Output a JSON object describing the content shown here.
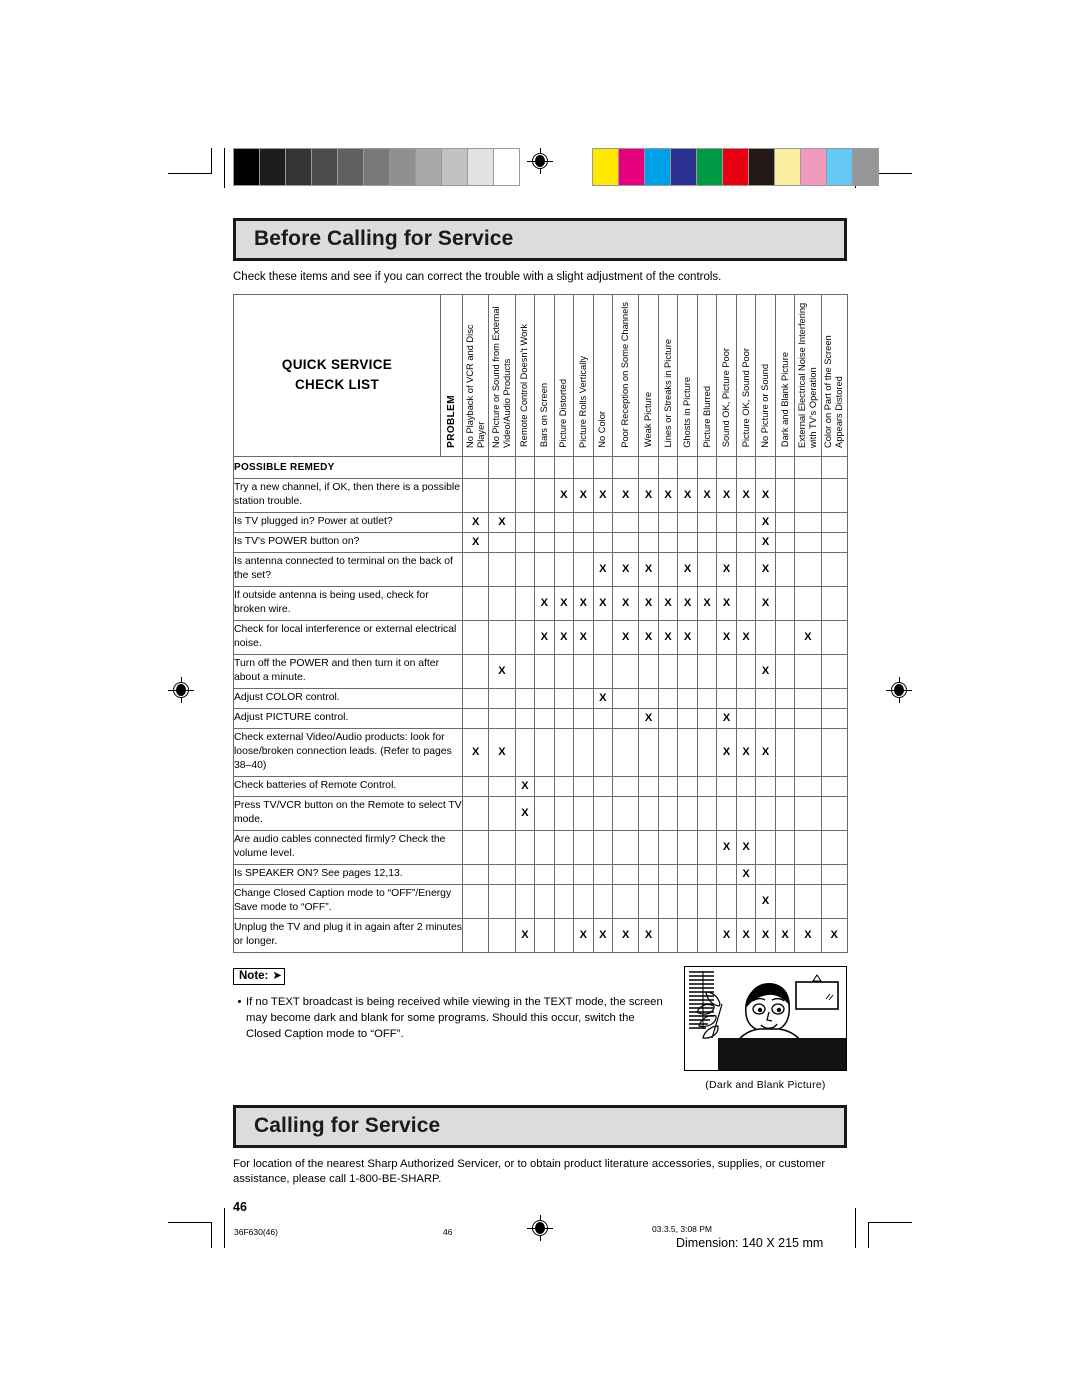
{
  "document": {
    "section1_title": "Before Calling for Service",
    "section1_lead": "Check these items and see if you can correct the trouble with a slight adjustment of the controls.",
    "section2_title": "Calling for Service",
    "section2_text": "For location of the nearest Sharp Authorized Servicer, or to obtain product literature accessories, supplies, or customer assistance, please call 1-800-BE-SHARP.",
    "page_number": "46"
  },
  "table": {
    "corner_title_line1": "QUICK SERVICE",
    "corner_title_line2": "CHECK LIST",
    "problem_label": "PROBLEM",
    "remedy_label": "POSSIBLE REMEDY",
    "columns": [
      "No Playback of VCR and Disc Player",
      "No Picture or Sound from External Video/Audio Products",
      "Remote Control Doesn't Work",
      "Bars on Screen",
      "Picture Distorted",
      "Picture Rolls Vertically",
      "No Color",
      "Poor Reception on Some Channels",
      "Weak  Picture",
      "Lines or Streaks in Picture",
      "Ghosts in Picture",
      "Picture Blurred",
      "Sound OK, Picture Poor",
      "Picture OK, Sound Poor",
      "No Picture or Sound",
      "Dark and Blank Picture",
      "External Electrical Noise Interfering with TV's Operation",
      "Color on Part of the Screen Appears Distored"
    ],
    "mark": "X",
    "rows": [
      {
        "remedy": "Try a new channel, if OK, then there is a possible station trouble.",
        "height": "r2",
        "marks": [
          0,
          0,
          0,
          0,
          1,
          1,
          1,
          1,
          1,
          1,
          1,
          1,
          1,
          1,
          1,
          0,
          0,
          0
        ]
      },
      {
        "remedy": "Is TV plugged in? Power at outlet?",
        "height": "r1",
        "marks": [
          1,
          1,
          0,
          0,
          0,
          0,
          0,
          0,
          0,
          0,
          0,
          0,
          0,
          0,
          1,
          0,
          0,
          0
        ]
      },
      {
        "remedy": "Is TV's POWER button on?",
        "height": "r1",
        "marks": [
          1,
          0,
          0,
          0,
          0,
          0,
          0,
          0,
          0,
          0,
          0,
          0,
          0,
          0,
          1,
          0,
          0,
          0
        ]
      },
      {
        "remedy": "Is antenna connected to terminal on the back of the set?",
        "height": "r2",
        "marks": [
          0,
          0,
          0,
          0,
          0,
          0,
          1,
          1,
          1,
          0,
          1,
          0,
          1,
          0,
          1,
          0,
          0,
          0
        ]
      },
      {
        "remedy": "If outside antenna is being used, check for broken wire.",
        "height": "r2",
        "marks": [
          0,
          0,
          0,
          1,
          1,
          1,
          1,
          1,
          1,
          1,
          1,
          1,
          1,
          0,
          1,
          0,
          0,
          0
        ]
      },
      {
        "remedy": "Check for local interference or external electrical noise.",
        "height": "r2",
        "marks": [
          0,
          0,
          0,
          1,
          1,
          1,
          0,
          1,
          1,
          1,
          1,
          0,
          1,
          1,
          0,
          0,
          1,
          0
        ]
      },
      {
        "remedy": "Turn off the POWER and then turn it on after about a minute.",
        "height": "r2",
        "marks": [
          0,
          1,
          0,
          0,
          0,
          0,
          0,
          0,
          0,
          0,
          0,
          0,
          0,
          0,
          1,
          0,
          0,
          0
        ]
      },
      {
        "remedy": "Adjust COLOR control.",
        "height": "r1",
        "marks": [
          0,
          0,
          0,
          0,
          0,
          0,
          1,
          0,
          0,
          0,
          0,
          0,
          0,
          0,
          0,
          0,
          0,
          0
        ]
      },
      {
        "remedy": "Adjust PICTURE control.",
        "height": "r1",
        "marks": [
          0,
          0,
          0,
          0,
          0,
          0,
          0,
          0,
          1,
          0,
          0,
          0,
          1,
          0,
          0,
          0,
          0,
          0
        ]
      },
      {
        "remedy": "Check external Video/Audio products: look for loose/broken connection leads. (Refer to pages 38–40)",
        "height": "r3",
        "marks": [
          1,
          1,
          0,
          0,
          0,
          0,
          0,
          0,
          0,
          0,
          0,
          0,
          1,
          1,
          1,
          0,
          0,
          0
        ]
      },
      {
        "remedy": "Check batteries of Remote Control.",
        "height": "r1",
        "marks": [
          0,
          0,
          1,
          0,
          0,
          0,
          0,
          0,
          0,
          0,
          0,
          0,
          0,
          0,
          0,
          0,
          0,
          0
        ]
      },
      {
        "remedy": "Press TV/VCR button on the Remote to select TV mode.",
        "height": "r2",
        "marks": [
          0,
          0,
          1,
          0,
          0,
          0,
          0,
          0,
          0,
          0,
          0,
          0,
          0,
          0,
          0,
          0,
          0,
          0
        ]
      },
      {
        "remedy": "Are audio cables connected firmly? Check the volume level.",
        "height": "r2",
        "marks": [
          0,
          0,
          0,
          0,
          0,
          0,
          0,
          0,
          0,
          0,
          0,
          0,
          1,
          1,
          0,
          0,
          0,
          0
        ]
      },
      {
        "remedy": "Is SPEAKER ON? See pages 12,13.",
        "height": "r1",
        "marks": [
          0,
          0,
          0,
          0,
          0,
          0,
          0,
          0,
          0,
          0,
          0,
          0,
          0,
          1,
          0,
          0,
          0,
          0
        ]
      },
      {
        "remedy": "Change Closed Caption mode to “OFF”/Energy Save mode to “OFF”.",
        "height": "r2",
        "marks": [
          0,
          0,
          0,
          0,
          0,
          0,
          0,
          0,
          0,
          0,
          0,
          0,
          0,
          0,
          1,
          0,
          0,
          0
        ]
      },
      {
        "remedy": "Unplug the TV and plug it in again after 2 minutes or longer.",
        "height": "r2",
        "marks": [
          0,
          0,
          1,
          0,
          0,
          1,
          1,
          1,
          1,
          0,
          0,
          0,
          1,
          1,
          1,
          1,
          1,
          1
        ]
      }
    ]
  },
  "note": {
    "label": "Note:",
    "bullet": "•",
    "text": "If no TEXT broadcast is being received while viewing in the TEXT mode, the screen may become dark and blank for some programs. Should this occur, switch the Closed Caption mode to “OFF”.",
    "illustration_caption": "(Dark and Blank Picture)"
  },
  "printer_footer": {
    "job_code": "36F630(46)",
    "page": "46",
    "timestamp": "03.3.5, 3:08 PM",
    "dimension": "Dimension: 140  X 215 mm"
  },
  "calibration": {
    "grayscale": [
      "#000000",
      "#1c1c1c",
      "#343434",
      "#4b4b4b",
      "#606060",
      "#787878",
      "#909090",
      "#a9a9a9",
      "#c2c2c2",
      "#e2e2e2",
      "#ffffff"
    ],
    "colors": [
      "#ffe800",
      "#e6007e",
      "#00a0e9",
      "#2b2f8f",
      "#009944",
      "#e60012",
      "#231815",
      "#fbefa0",
      "#f09bbd",
      "#65c8f4",
      "#949698"
    ]
  }
}
